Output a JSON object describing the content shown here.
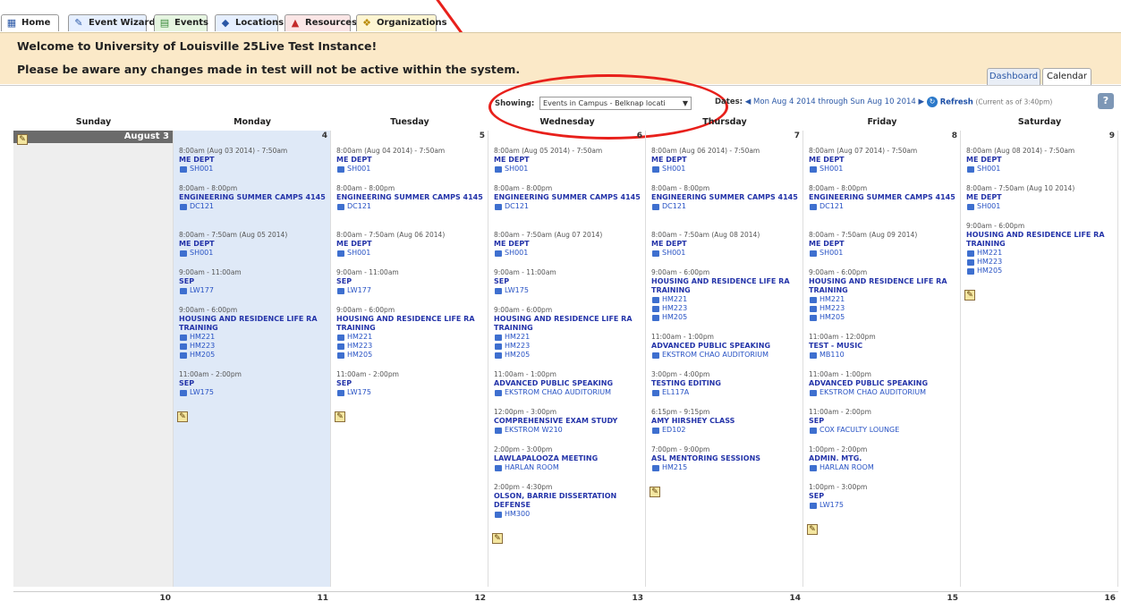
{
  "tabs": [
    {
      "label": "Home",
      "icon": "home-icon"
    },
    {
      "label": "Event Wizard",
      "icon": "wizard-icon"
    },
    {
      "label": "Events",
      "icon": "events-icon"
    },
    {
      "label": "Locations",
      "icon": "locations-icon"
    },
    {
      "label": "Resources",
      "icon": "resources-icon"
    },
    {
      "label": "Organizations",
      "icon": "organizations-icon"
    }
  ],
  "banner": {
    "line1": "Welcome to University of Louisville 25Live Test Instance!",
    "line2": "Please be aware any changes made in test will not be active within the system."
  },
  "view_tabs": {
    "dashboard": "Dashboard",
    "calendar": "Calendar"
  },
  "toolbar": {
    "showing_label": "Showing:",
    "showing_value": "Events in Campus - Belknap locati",
    "dates_label": "Dates:",
    "date_range": "Mon Aug 4 2014 through Sun Aug 10 2014",
    "refresh_label": "Refresh",
    "refresh_note": "(Current as of 3:40pm)",
    "help": "?"
  },
  "week": {
    "headers": [
      "Sunday",
      "Monday",
      "Tuesday",
      "Wednesday",
      "Thursday",
      "Friday",
      "Saturday"
    ],
    "month_label": "August 3",
    "day_numbers": [
      "",
      "4",
      "5",
      "6",
      "7",
      "8",
      "9"
    ],
    "next_day_numbers": [
      "10",
      "11",
      "12",
      "13",
      "14",
      "15",
      "16"
    ]
  },
  "days": [
    {
      "events": []
    },
    {
      "events": [
        {
          "time": "8:00am (Aug 03 2014) - 7:50am",
          "name": "ME DEPT",
          "locations": [
            "SH001"
          ]
        },
        {
          "time": "8:00am - 8:00pm",
          "name": "ENGINEERING SUMMER CAMPS 4145",
          "locations": [
            "DC121"
          ]
        },
        {
          "time": "8:00am - 7:50am (Aug 05 2014)",
          "name": "ME DEPT",
          "locations": [
            "SH001"
          ]
        },
        {
          "time": "9:00am - 11:00am",
          "name": "SEP",
          "locations": [
            "LW177"
          ]
        },
        {
          "time": "9:00am - 6:00pm",
          "name": "HOUSING AND RESIDENCE LIFE RA TRAINING",
          "locations": [
            "HM221",
            "HM223",
            "HM205"
          ]
        },
        {
          "time": "11:00am - 2:00pm",
          "name": "SEP",
          "locations": [
            "LW175"
          ]
        }
      ]
    },
    {
      "events": [
        {
          "time": "8:00am (Aug 04 2014) - 7:50am",
          "name": "ME DEPT",
          "locations": [
            "SH001"
          ]
        },
        {
          "time": "8:00am - 8:00pm",
          "name": "ENGINEERING SUMMER CAMPS 4145",
          "locations": [
            "DC121"
          ]
        },
        {
          "time": "8:00am - 7:50am (Aug 06 2014)",
          "name": "ME DEPT",
          "locations": [
            "SH001"
          ]
        },
        {
          "time": "9:00am - 11:00am",
          "name": "SEP",
          "locations": [
            "LW177"
          ]
        },
        {
          "time": "9:00am - 6:00pm",
          "name": "HOUSING AND RESIDENCE LIFE RA TRAINING",
          "locations": [
            "HM221",
            "HM223",
            "HM205"
          ]
        },
        {
          "time": "11:00am - 2:00pm",
          "name": "SEP",
          "locations": [
            "LW175"
          ]
        }
      ]
    },
    {
      "events": [
        {
          "time": "8:00am (Aug 05 2014) - 7:50am",
          "name": "ME DEPT",
          "locations": [
            "SH001"
          ]
        },
        {
          "time": "8:00am - 8:00pm",
          "name": "ENGINEERING SUMMER CAMPS 4145",
          "locations": [
            "DC121"
          ]
        },
        {
          "time": "8:00am - 7:50am (Aug 07 2014)",
          "name": "ME DEPT",
          "locations": [
            "SH001"
          ]
        },
        {
          "time": "9:00am - 11:00am",
          "name": "SEP",
          "locations": [
            "LW175"
          ]
        },
        {
          "time": "9:00am - 6:00pm",
          "name": "HOUSING AND RESIDENCE LIFE RA TRAINING",
          "locations": [
            "HM221",
            "HM223",
            "HM205"
          ]
        },
        {
          "time": "11:00am - 1:00pm",
          "name": "ADVANCED PUBLIC SPEAKING",
          "locations": [
            "EKSTROM CHAO AUDITORIUM"
          ]
        },
        {
          "time": "12:00pm - 3:00pm",
          "name": "COMPREHENSIVE EXAM STUDY",
          "locations": [
            "EKSTROM W210"
          ]
        },
        {
          "time": "2:00pm - 3:00pm",
          "name": "LAWLAPALOOZA MEETING",
          "locations": [
            "HARLAN ROOM"
          ]
        },
        {
          "time": "2:00pm - 4:30pm",
          "name": "OLSON, BARRIE DISSERTATION DEFENSE",
          "locations": [
            "HM300"
          ]
        }
      ]
    },
    {
      "events": [
        {
          "time": "8:00am (Aug 06 2014) - 7:50am",
          "name": "ME DEPT",
          "locations": [
            "SH001"
          ]
        },
        {
          "time": "8:00am - 8:00pm",
          "name": "ENGINEERING SUMMER CAMPS 4145",
          "locations": [
            "DC121"
          ]
        },
        {
          "time": "8:00am - 7:50am (Aug 08 2014)",
          "name": "ME DEPT",
          "locations": [
            "SH001"
          ]
        },
        {
          "time": "9:00am - 6:00pm",
          "name": "HOUSING AND RESIDENCE LIFE RA TRAINING",
          "locations": [
            "HM221",
            "HM223",
            "HM205"
          ]
        },
        {
          "time": "11:00am - 1:00pm",
          "name": "ADVANCED PUBLIC SPEAKING",
          "locations": [
            "EKSTROM CHAO AUDITORIUM"
          ]
        },
        {
          "time": "3:00pm - 4:00pm",
          "name": "TESTING EDITING",
          "locations": [
            "EL117A"
          ]
        },
        {
          "time": "6:15pm - 9:15pm",
          "name": "AMY HIRSHEY CLASS",
          "locations": [
            "ED102"
          ]
        },
        {
          "time": "7:00pm - 9:00pm",
          "name": "ASL MENTORING SESSIONS",
          "locations": [
            "HM215"
          ]
        }
      ]
    },
    {
      "events": [
        {
          "time": "8:00am (Aug 07 2014) - 7:50am",
          "name": "ME DEPT",
          "locations": [
            "SH001"
          ]
        },
        {
          "time": "8:00am - 8:00pm",
          "name": "ENGINEERING SUMMER CAMPS 4145",
          "locations": [
            "DC121"
          ]
        },
        {
          "time": "8:00am - 7:50am (Aug 09 2014)",
          "name": "ME DEPT",
          "locations": [
            "SH001"
          ]
        },
        {
          "time": "9:00am - 6:00pm",
          "name": "HOUSING AND RESIDENCE LIFE RA TRAINING",
          "locations": [
            "HM221",
            "HM223",
            "HM205"
          ]
        },
        {
          "time": "11:00am - 12:00pm",
          "name": "TEST - MUSIC",
          "locations": [
            "MB110"
          ]
        },
        {
          "time": "11:00am - 1:00pm",
          "name": "ADVANCED PUBLIC SPEAKING",
          "locations": [
            "EKSTROM CHAO AUDITORIUM"
          ]
        },
        {
          "time": "11:00am - 2:00pm",
          "name": "SEP",
          "locations": [
            "COX FACULTY LOUNGE"
          ]
        },
        {
          "time": "1:00pm - 2:00pm",
          "name": "ADMIN. MTG.",
          "locations": [
            "HARLAN ROOM"
          ]
        },
        {
          "time": "1:00pm - 3:00pm",
          "name": "SEP",
          "locations": [
            "LW175"
          ]
        }
      ]
    },
    {
      "events": [
        {
          "time": "8:00am (Aug 08 2014) - 7:50am",
          "name": "ME DEPT",
          "locations": [
            "SH001"
          ]
        },
        {
          "time": "8:00am - 7:50am (Aug 10 2014)",
          "name": "ME DEPT",
          "locations": [
            "SH001"
          ]
        },
        {
          "time": "9:00am - 6:00pm",
          "name": "HOUSING AND RESIDENCE LIFE RA TRAINING",
          "locations": [
            "HM221",
            "HM223",
            "HM205"
          ]
        }
      ]
    }
  ],
  "colors": {
    "banner": "#fbe9c8",
    "event_name": "#2434a9",
    "location": "#2651c4",
    "annotation": "#e8201b",
    "today": "#dfe9f7"
  }
}
